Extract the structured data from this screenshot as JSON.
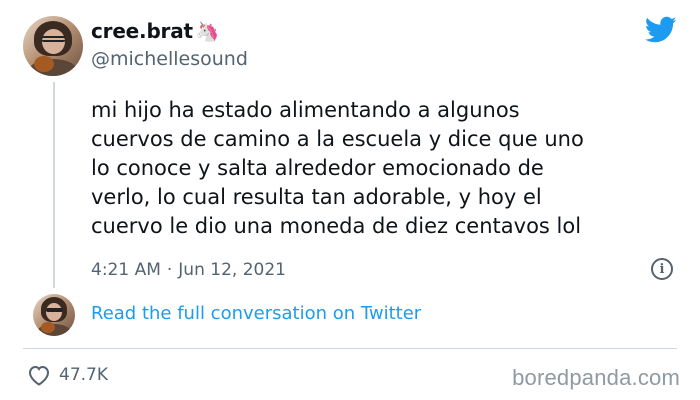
{
  "user": {
    "display_name": "cree.brat",
    "name_emoji": "🦄",
    "handle": "@michellesound"
  },
  "tweet": {
    "lines": [
      "mi hijo ha estado alimentando a algunos",
      "cuervos de camino a la escuela y dice que uno",
      "lo conoce y salta alrededor emocionado de",
      "verlo, lo cual resulta tan adorable, y hoy el",
      "cuervo le dio una moneda de diez centavos lol"
    ],
    "time": "4:21 AM",
    "separator": "·",
    "date": "Jun 12, 2021"
  },
  "links": {
    "full_conversation": "Read the full conversation on Twitter"
  },
  "stats": {
    "likes": "47.7K"
  },
  "watermark": "boredpanda.com",
  "colors": {
    "accent": "#1d9bf0",
    "secondary_text": "#536471",
    "divider": "#cfd9de"
  },
  "icons": {
    "brand": "twitter-bird-icon",
    "info": "info-icon",
    "like": "heart-icon"
  }
}
